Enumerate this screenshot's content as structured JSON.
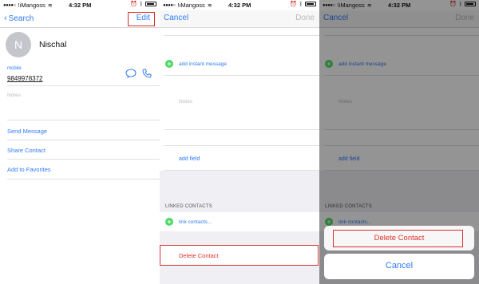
{
  "status": {
    "carrier": "!iMangoss",
    "time": "4:32 PM"
  },
  "panel1": {
    "nav_back": "Search",
    "nav_edit": "Edit",
    "avatar_initial": "N",
    "contact_name": "Nischal",
    "mobile_label": "mobile",
    "mobile_number": "9849978372",
    "notes_label": "Notes",
    "actions": [
      "Send Message",
      "Share Contact",
      "Add to Favorites"
    ]
  },
  "panel2": {
    "nav_cancel": "Cancel",
    "nav_done": "Done",
    "add_instant_message": "add instant message",
    "notes_label": "Notes",
    "add_field": "add field",
    "linked_contacts_title": "LINKED CONTACTS",
    "link_contacts": "link contacts...",
    "delete_contact": "Delete Contact"
  },
  "panel3": {
    "nav_cancel": "Cancel",
    "nav_done": "Done",
    "add_instant_message": "add instant message",
    "notes_label": "Notes",
    "add_field": "add field",
    "linked_contacts_title": "LINKED CONTACTS",
    "link_contacts": "link contacts...",
    "sheet_delete": "Delete Contact",
    "sheet_cancel": "Cancel"
  },
  "colors": {
    "accent": "#2f7cf6",
    "delete": "#e0302b",
    "highlight_box": "#d83030",
    "plus_green": "#4cd964"
  },
  "icons": [
    "chevron-left-icon",
    "message-icon",
    "phone-icon",
    "wifi-icon",
    "battery-icon",
    "plus-icon"
  ]
}
